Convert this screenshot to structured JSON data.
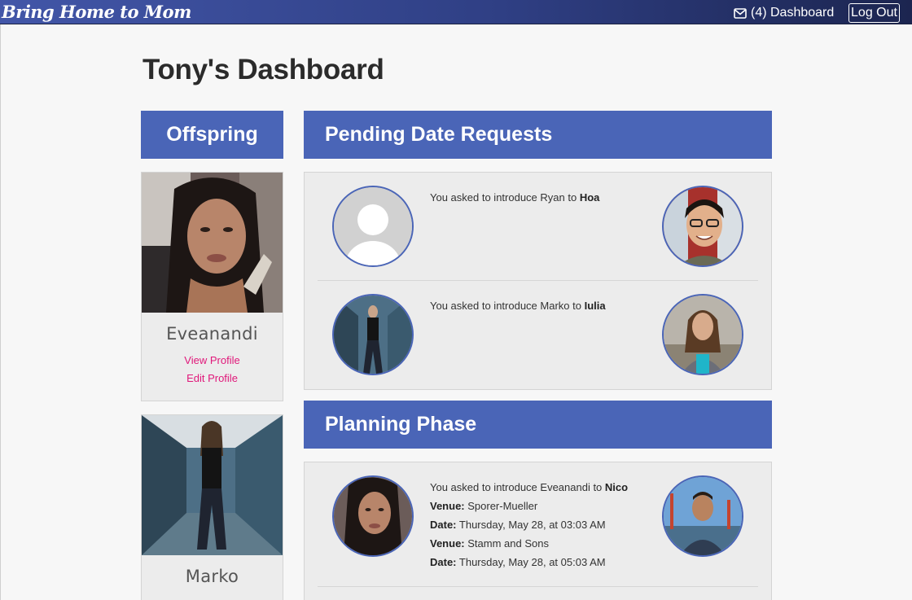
{
  "nav": {
    "brand": "Bring Home to Mom",
    "dashboard_label": "(4) Dashboard",
    "logout_label": "Log Out",
    "icon": "envelope-icon"
  },
  "page": {
    "title": "Tony's Dashboard"
  },
  "sidebar": {
    "header": "Offspring",
    "cards": [
      {
        "name": "Eveanandi",
        "view_label": "View Profile",
        "edit_label": "Edit Profile"
      },
      {
        "name": "Marko"
      }
    ]
  },
  "pending": {
    "header": "Pending Date Requests",
    "requests": [
      {
        "prefix": "You asked to introduce Ryan to ",
        "match": "Hoa"
      },
      {
        "prefix": "You asked to introduce Marko to ",
        "match": "Iulia"
      }
    ]
  },
  "planning": {
    "header": "Planning Phase",
    "items": [
      {
        "prefix": "You asked to introduce Eveanandi to ",
        "match": "Nico",
        "details": [
          {
            "label": "Venue:",
            "value": " Sporer-Mueller"
          },
          {
            "label": "Date:",
            "value": " Thursday, May 28, at 03:03 AM"
          },
          {
            "label": "Venue:",
            "value": " Stamm and Sons"
          },
          {
            "label": "Date:",
            "value": " Thursday, May 28, at 05:03 AM"
          }
        ]
      }
    ]
  },
  "colors": {
    "header_bar": "#4a65b7",
    "link": "#e0187a",
    "avatar_border": "#4a65b7"
  }
}
